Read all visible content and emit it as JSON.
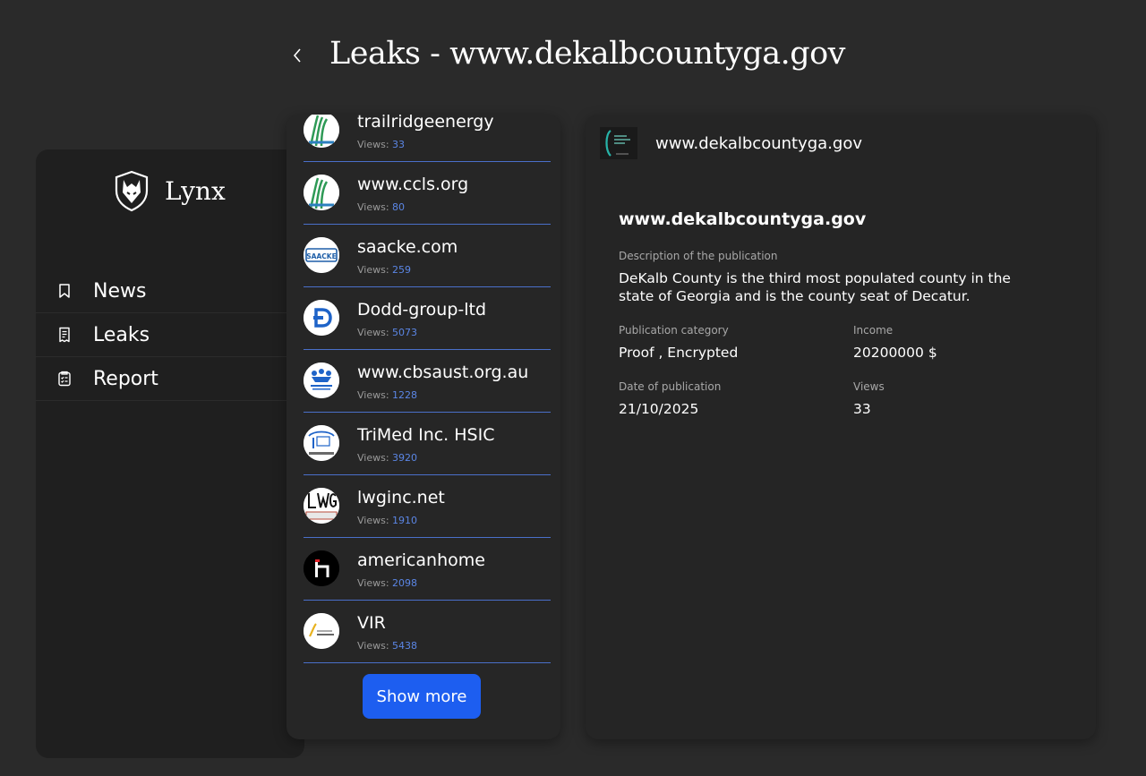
{
  "header": {
    "title": "Leaks - www.dekalbcountyga.gov",
    "back_icon": "chevron-left-icon"
  },
  "sidebar": {
    "brand": "Lynx",
    "items": [
      {
        "label": "News",
        "icon": "bookmark-icon"
      },
      {
        "label": "Leaks",
        "icon": "receipt-icon"
      },
      {
        "label": "Report",
        "icon": "clipboard-check-icon"
      }
    ]
  },
  "leaks": {
    "views_label": "Views:",
    "items": [
      {
        "name": "trailridgeenergy",
        "views": "33"
      },
      {
        "name": "www.ccls.org",
        "views": "80"
      },
      {
        "name": "saacke.com",
        "views": "259",
        "logo_text": "SAACKE"
      },
      {
        "name": "Dodd-group-ltd",
        "views": "5073"
      },
      {
        "name": "www.cbsaust.org.au",
        "views": "1228"
      },
      {
        "name": "TriMed Inc. HSIC",
        "views": "3920"
      },
      {
        "name": "lwginc.net",
        "views": "1910"
      },
      {
        "name": "americanhome",
        "views": "2098"
      },
      {
        "name": "VIR",
        "views": "5438"
      }
    ],
    "show_more": "Show more"
  },
  "detail": {
    "domain": "www.dekalbcountyga.gov",
    "title": "www.dekalbcountyga.gov",
    "description_label": "Description of the publication",
    "description": "DeKalb County is the third most populated county in the state of Georgia and is the county seat of Decatur.",
    "category_label": "Publication category",
    "category": "Proof , Encrypted",
    "income_label": "Income",
    "income": "20200000 $",
    "date_label": "Date of publication",
    "date": "21/10/2025",
    "views_label": "Views",
    "views": "33"
  },
  "colors": {
    "accent": "#1d5ef0",
    "divider": "#4a6fc9",
    "views_count": "#5b86e5",
    "background": "#2a2a2a"
  }
}
